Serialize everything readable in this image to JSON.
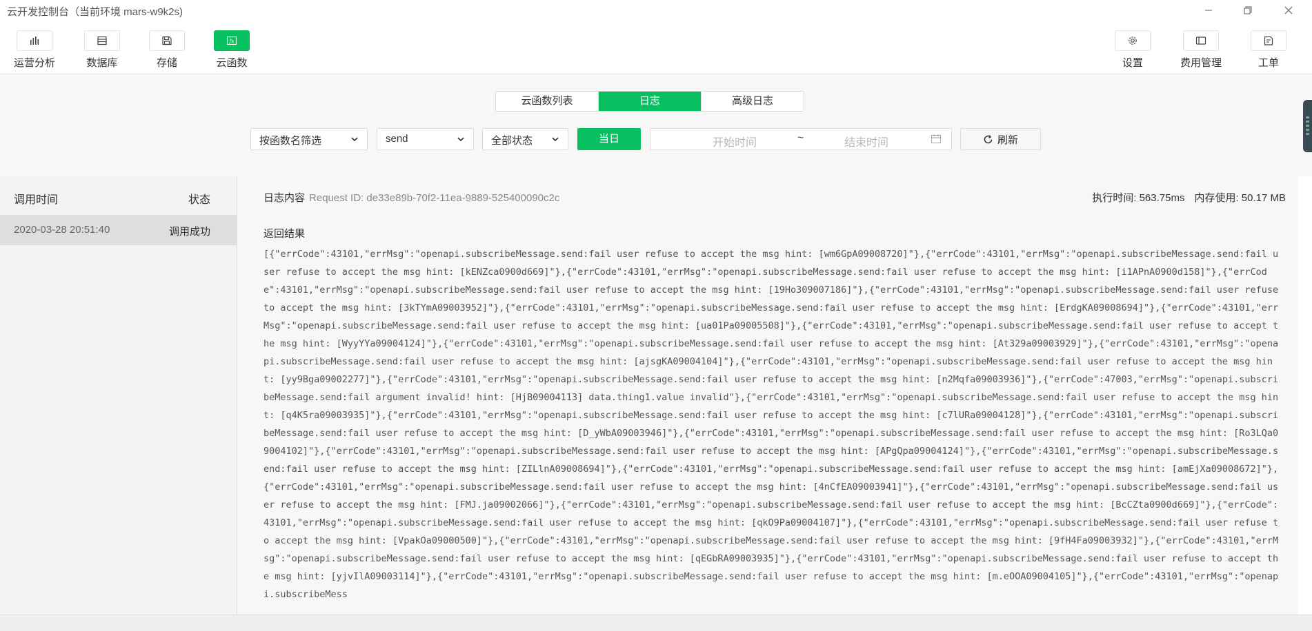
{
  "window": {
    "title": "云开发控制台（当前环境 mars-w9k2s)"
  },
  "toolbar": {
    "left": [
      {
        "label": "运营分析",
        "icon": "bar-chart-icon"
      },
      {
        "label": "数据库",
        "icon": "database-icon"
      },
      {
        "label": "存储",
        "icon": "save-icon"
      },
      {
        "label": "云函数",
        "icon": "function-icon",
        "active": true
      }
    ],
    "right": [
      {
        "label": "设置",
        "icon": "gear-icon"
      },
      {
        "label": "费用管理",
        "icon": "billing-icon"
      },
      {
        "label": "工单",
        "icon": "ticket-icon"
      }
    ]
  },
  "tabs": [
    {
      "label": "云函数列表",
      "active": false
    },
    {
      "label": "日志",
      "active": true
    },
    {
      "label": "高级日志",
      "active": false
    }
  ],
  "filters": {
    "function_filter": "按函数名筛选",
    "function_name": "send",
    "status": "全部状态",
    "today_label": "当日",
    "start_placeholder": "开始时间",
    "separator": "~",
    "end_placeholder": "结束时间",
    "refresh_label": "刷新"
  },
  "list": {
    "header_time": "调用时间",
    "header_status": "状态",
    "rows": [
      {
        "time": "2020-03-28 20:51:40",
        "status": "调用成功"
      }
    ]
  },
  "detail": {
    "content_label": "日志内容",
    "request_id": "Request ID: de33e89b-70f2-11ea-9889-525400090c2c",
    "exec_time": "执行时间: 563.75ms",
    "memory": "内存使用: 50.17 MB",
    "result_label": "返回结果",
    "result_text": "[{\"errCode\":43101,\"errMsg\":\"openapi.subscribeMessage.send:fail user refuse to accept the msg hint: [wm6GpA09008720]\"},{\"errCode\":43101,\"errMsg\":\"openapi.subscribeMessage.send:fail user refuse to accept the msg hint: [kENZca0900d669]\"},{\"errCode\":43101,\"errMsg\":\"openapi.subscribeMessage.send:fail user refuse to accept the msg hint: [i1APnA0900d158]\"},{\"errCode\":43101,\"errMsg\":\"openapi.subscribeMessage.send:fail user refuse to accept the msg hint: [19Ho309007186]\"},{\"errCode\":43101,\"errMsg\":\"openapi.subscribeMessage.send:fail user refuse to accept the msg hint: [3kTYmA09003952]\"},{\"errCode\":43101,\"errMsg\":\"openapi.subscribeMessage.send:fail user refuse to accept the msg hint: [ErdgKA09008694]\"},{\"errCode\":43101,\"errMsg\":\"openapi.subscribeMessage.send:fail user refuse to accept the msg hint: [ua01Pa09005508]\"},{\"errCode\":43101,\"errMsg\":\"openapi.subscribeMessage.send:fail user refuse to accept the msg hint: [WyyYYa09004124]\"},{\"errCode\":43101,\"errMsg\":\"openapi.subscribeMessage.send:fail user refuse to accept the msg hint: [At329a09003929]\"},{\"errCode\":43101,\"errMsg\":\"openapi.subscribeMessage.send:fail user refuse to accept the msg hint: [ajsgKA09004104]\"},{\"errCode\":43101,\"errMsg\":\"openapi.subscribeMessage.send:fail user refuse to accept the msg hint: [yy9Bga09002277]\"},{\"errCode\":43101,\"errMsg\":\"openapi.subscribeMessage.send:fail user refuse to accept the msg hint: [n2Mqfa09003936]\"},{\"errCode\":47003,\"errMsg\":\"openapi.subscribeMessage.send:fail argument invalid! hint: [HjB09004113] data.thing1.value invalid\"},{\"errCode\":43101,\"errMsg\":\"openapi.subscribeMessage.send:fail user refuse to accept the msg hint: [q4K5ra09003935]\"},{\"errCode\":43101,\"errMsg\":\"openapi.subscribeMessage.send:fail user refuse to accept the msg hint: [c7lURa09004128]\"},{\"errCode\":43101,\"errMsg\":\"openapi.subscribeMessage.send:fail user refuse to accept the msg hint: [D_yWbA09003946]\"},{\"errCode\":43101,\"errMsg\":\"openapi.subscribeMessage.send:fail user refuse to accept the msg hint: [Ro3LQa09004102]\"},{\"errCode\":43101,\"errMsg\":\"openapi.subscribeMessage.send:fail user refuse to accept the msg hint: [APgQpa09004124]\"},{\"errCode\":43101,\"errMsg\":\"openapi.subscribeMessage.send:fail user refuse to accept the msg hint: [ZILlnA09008694]\"},{\"errCode\":43101,\"errMsg\":\"openapi.subscribeMessage.send:fail user refuse to accept the msg hint: [amEjXa09008672]\"},{\"errCode\":43101,\"errMsg\":\"openapi.subscribeMessage.send:fail user refuse to accept the msg hint: [4nCfEA09003941]\"},{\"errCode\":43101,\"errMsg\":\"openapi.subscribeMessage.send:fail user refuse to accept the msg hint: [FMJ.ja09002066]\"},{\"errCode\":43101,\"errMsg\":\"openapi.subscribeMessage.send:fail user refuse to accept the msg hint: [BcCZta0900d669]\"},{\"errCode\":43101,\"errMsg\":\"openapi.subscribeMessage.send:fail user refuse to accept the msg hint: [qkO9Pa09004107]\"},{\"errCode\":43101,\"errMsg\":\"openapi.subscribeMessage.send:fail user refuse to accept the msg hint: [VpakOa09000500]\"},{\"errCode\":43101,\"errMsg\":\"openapi.subscribeMessage.send:fail user refuse to accept the msg hint: [9fH4Fa09003932]\"},{\"errCode\":43101,\"errMsg\":\"openapi.subscribeMessage.send:fail user refuse to accept the msg hint: [qEGbRA09003935]\"},{\"errCode\":43101,\"errMsg\":\"openapi.subscribeMessage.send:fail user refuse to accept the msg hint: [yjvIlA09003114]\"},{\"errCode\":43101,\"errMsg\":\"openapi.subscribeMessage.send:fail user refuse to accept the msg hint: [m.eOOA09004105]\"},{\"errCode\":43101,\"errMsg\":\"openapi.subscribeMess"
  },
  "colors": {
    "accent": "#07c160",
    "panel": "#f7f7f7",
    "selected_row": "#dedede"
  }
}
